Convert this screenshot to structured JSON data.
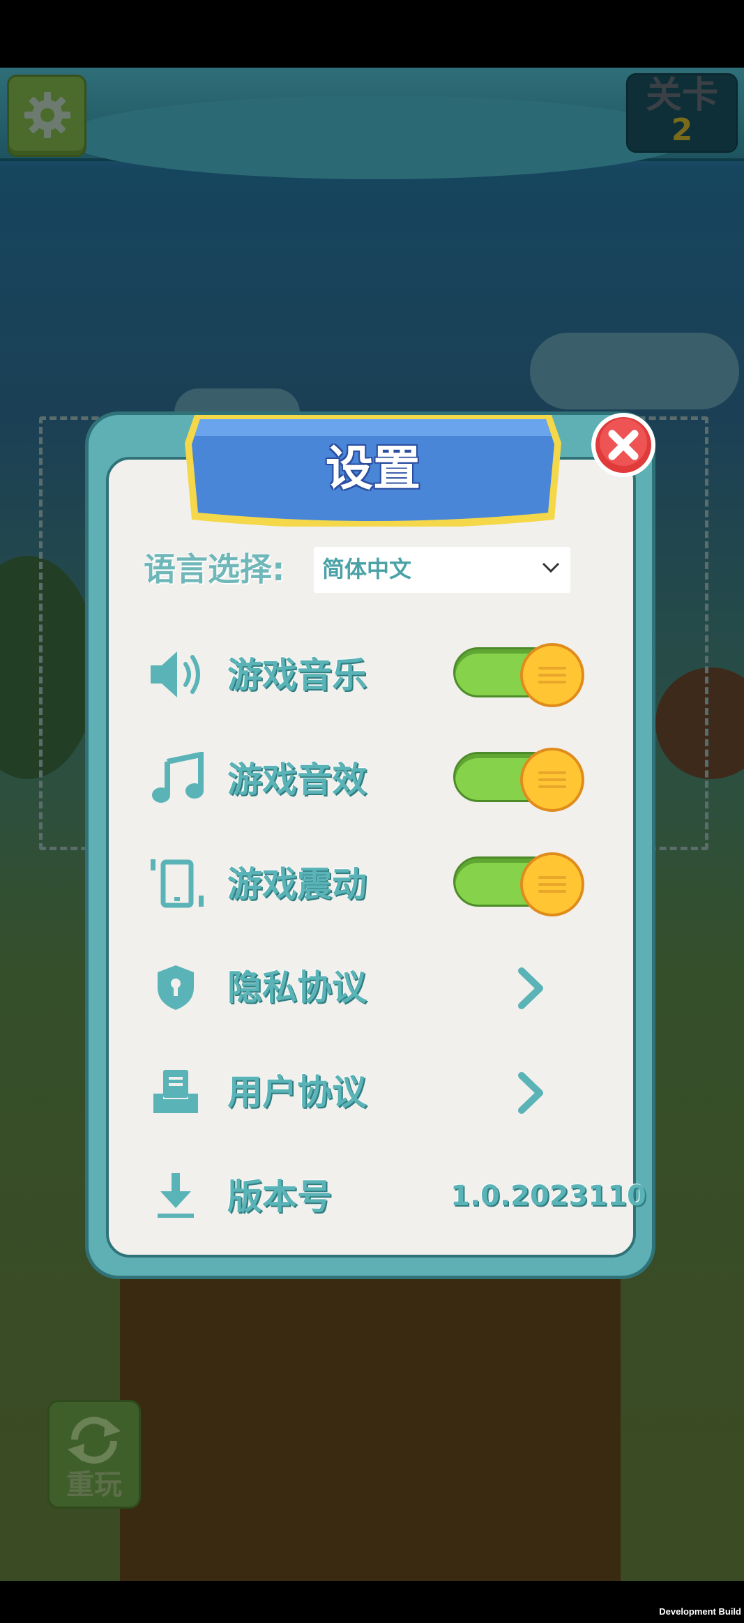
{
  "hud": {
    "level_label": "关卡",
    "level_number": "2",
    "replay_label": "重玩"
  },
  "settings": {
    "title": "设置",
    "language": {
      "label": "语言选择:",
      "selected": "简体中文"
    },
    "rows": {
      "music": {
        "label": "游戏音乐",
        "icon": "speaker-icon",
        "enabled": true
      },
      "sound": {
        "label": "游戏音效",
        "icon": "music-note-icon",
        "enabled": true
      },
      "vibration": {
        "label": "游戏震动",
        "icon": "vibrate-icon",
        "enabled": true
      },
      "privacy": {
        "label": "隐私协议",
        "icon": "shield-icon"
      },
      "user_agreement": {
        "label": "用户协议",
        "icon": "document-tray-icon"
      },
      "version": {
        "label": "版本号",
        "icon": "download-icon",
        "value": "1.0.2023110"
      }
    }
  },
  "footer": {
    "build_text": "Development Build"
  },
  "colors": {
    "panel_teal": "#5fb0b4",
    "panel_inner": "#f2f0ec",
    "title_blue": "#4a86d8",
    "toggle_green": "#86d24b",
    "toggle_knob": "#ffc533",
    "close_red": "#e03a3a"
  }
}
